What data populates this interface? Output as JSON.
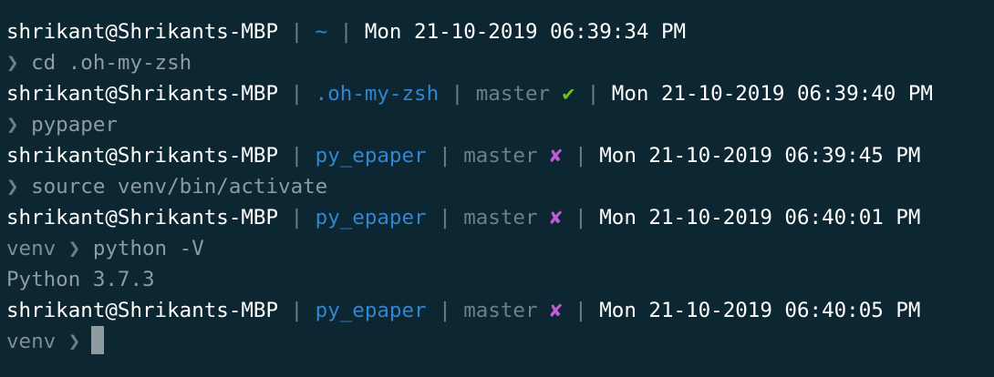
{
  "lines": [
    {
      "type": "status",
      "user": "shrikant@Shrikants-MBP",
      "sep": "|",
      "path": "~",
      "timestamp": "Mon 21-10-2019 06:39:34 PM"
    },
    {
      "type": "command",
      "prompt": "❯",
      "command": "cd .oh-my-zsh"
    },
    {
      "type": "status",
      "user": "shrikant@Shrikants-MBP",
      "sep": "|",
      "path": ".oh-my-zsh",
      "branch": "master",
      "git_status": "✔",
      "timestamp": "Mon 21-10-2019 06:39:40 PM"
    },
    {
      "type": "command",
      "prompt": "❯",
      "command": "pypaper"
    },
    {
      "type": "status",
      "user": "shrikant@Shrikants-MBP",
      "sep": "|",
      "path": "py_epaper",
      "branch": "master",
      "git_status": "✘",
      "timestamp": "Mon 21-10-2019 06:39:45 PM"
    },
    {
      "type": "command",
      "prompt": "❯",
      "command": "source venv/bin/activate"
    },
    {
      "type": "status",
      "user": "shrikant@Shrikants-MBP",
      "sep": "|",
      "path": "py_epaper",
      "branch": "master",
      "git_status": "✘",
      "timestamp": "Mon 21-10-2019 06:40:01 PM"
    },
    {
      "type": "command",
      "venv": "venv",
      "prompt": "❯",
      "command": "python -V"
    },
    {
      "type": "output",
      "text": "Python 3.7.3"
    },
    {
      "type": "status",
      "user": "shrikant@Shrikants-MBP",
      "sep": "|",
      "path": "py_epaper",
      "branch": "master",
      "git_status": "✘",
      "timestamp": "Mon 21-10-2019 06:40:05 PM"
    },
    {
      "type": "command",
      "venv": "venv",
      "prompt": "❯",
      "command": ""
    }
  ],
  "colors": {
    "background": "#0c2732",
    "user_text": "#ffffff",
    "path": "#2f86d2",
    "git_clean": "#74c313",
    "git_dirty": "#c25cd6",
    "muted": "#6e7f86",
    "command_text": "#8e9ba1"
  }
}
